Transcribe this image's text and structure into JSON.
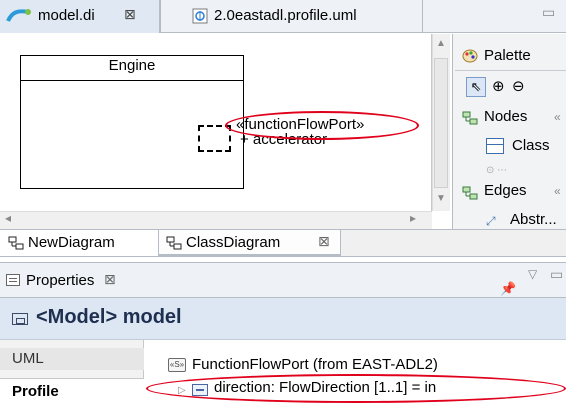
{
  "editor_tabs": [
    {
      "label": "model.di",
      "close": "⊠",
      "icon": "papyrus-diagram-icon",
      "active": true
    },
    {
      "label": "2.0eastadl.profile.uml",
      "icon": "uml-model-file-icon",
      "active": false
    }
  ],
  "window_controls": {
    "minimize": "▭"
  },
  "diagram": {
    "class_name": "Engine",
    "port_stereotype": "«functionFlowPort»",
    "port_attribute": "+ accelerator"
  },
  "palette": {
    "title": "Palette",
    "tools": {
      "select": "⇖",
      "zoom_in": "⊕",
      "zoom_out": "⊖"
    },
    "drawers": [
      {
        "label": "Nodes",
        "items": [
          "Class"
        ]
      },
      {
        "label": "Edges",
        "items": [
          "Abstr..."
        ]
      }
    ],
    "pin_glyph": "«"
  },
  "diagram_tabs": [
    {
      "label": "NewDiagram",
      "active": false
    },
    {
      "label": "ClassDiagram",
      "active": true,
      "close": "⊠"
    }
  ],
  "properties_view": {
    "title": "Properties",
    "close": "⊠",
    "header": {
      "prefix": "<Model>",
      "name": "model"
    },
    "side_tabs": [
      "UML",
      "Profile"
    ],
    "selected_side_tab": "Profile",
    "stereotype_application": "FunctionFlowPort   (from EAST-ADL2)",
    "property": "direction: FlowDirection [1..1] = in"
  },
  "colors": {
    "highlight": "#e0001b",
    "header_bg": "#dde7f3",
    "tab_bar_bg": "#eef1f6"
  }
}
